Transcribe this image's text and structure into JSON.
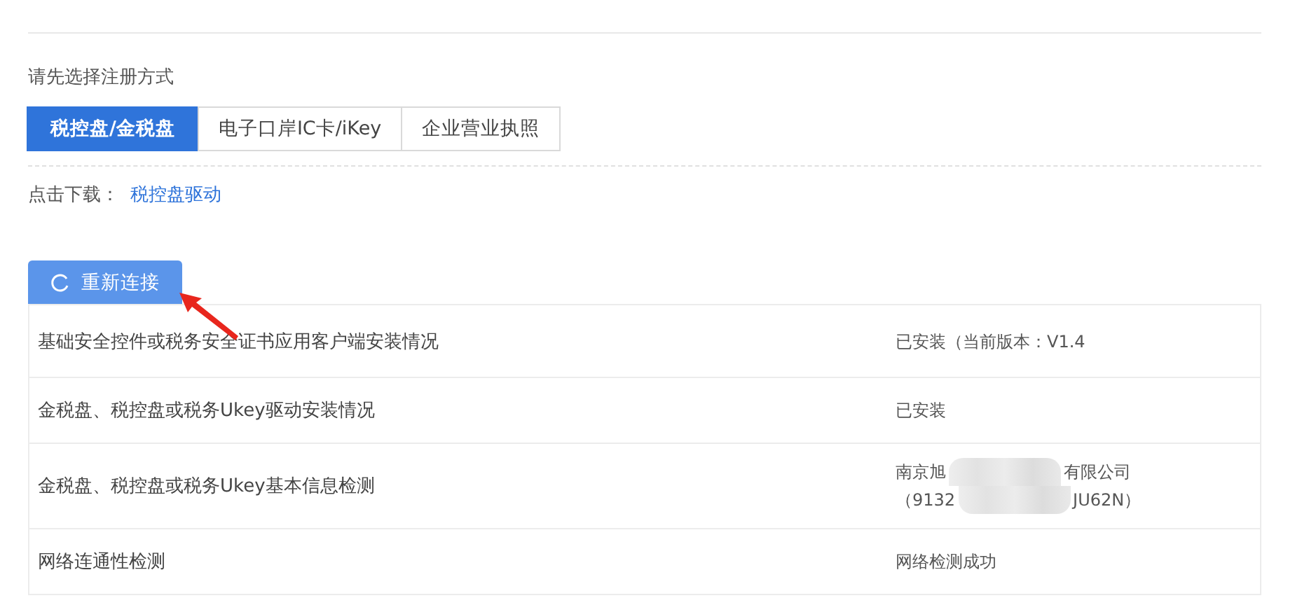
{
  "prompt": "请先选择注册方式",
  "tabs": [
    {
      "label": "税控盘/金税盘",
      "selected": true
    },
    {
      "label": "电子口岸IC卡/iKey",
      "selected": false
    },
    {
      "label": "企业营业执照",
      "selected": false
    }
  ],
  "download": {
    "label": "点击下载：",
    "link": "税控盘驱动"
  },
  "reconnect_button": "重新连接",
  "checks": [
    {
      "item": "基础安全控件或税务安全证书应用客户端安装情况",
      "result": [
        "已安装（当前版本：V1.4"
      ]
    },
    {
      "item": "金税盘、税控盘或税务Ukey驱动安装情况",
      "result": [
        "已安装"
      ]
    },
    {
      "item": "金税盘、税控盘或税务Ukey基本信息检测",
      "result": [
        "南京旭",
        "有限公司",
        "（9132",
        "JU62N）"
      ],
      "redacted": true
    },
    {
      "item": "网络连通性检测",
      "result": [
        "网络检测成功"
      ]
    }
  ]
}
